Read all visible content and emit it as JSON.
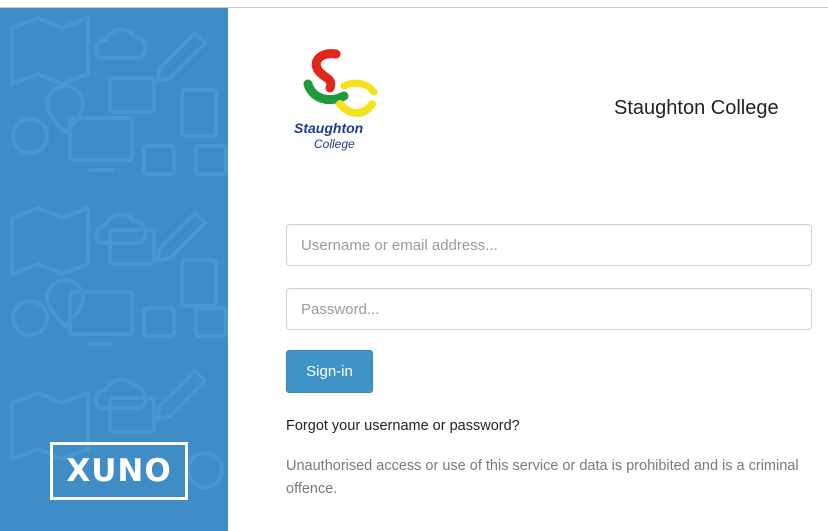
{
  "branding": {
    "product_logo_text": "XUNO",
    "college_logo_line1": "Staughton",
    "college_logo_line2": "College",
    "college_name": "Staughton College"
  },
  "login": {
    "username_placeholder": "Username or email address...",
    "username_value": "",
    "password_placeholder": "Password...",
    "password_value": "",
    "signin_label": "Sign-in",
    "forgot_link": "Forgot your username or password?",
    "notice": "Unauthorised access or use of this service or data is prohibited and is a criminal offence."
  },
  "colors": {
    "sidebar": "#3f8cc6",
    "button": "#3f93c6",
    "logo_red": "#e1261c",
    "logo_green": "#1f9a3a",
    "logo_yellow": "#f4e21b",
    "logo_text": "#213a8f"
  },
  "icons": [
    "map-icon",
    "location-pin-icon",
    "cloud-icon",
    "pencil-icon",
    "document-icon",
    "monitor-icon",
    "calendar-icon",
    "clock-icon"
  ]
}
